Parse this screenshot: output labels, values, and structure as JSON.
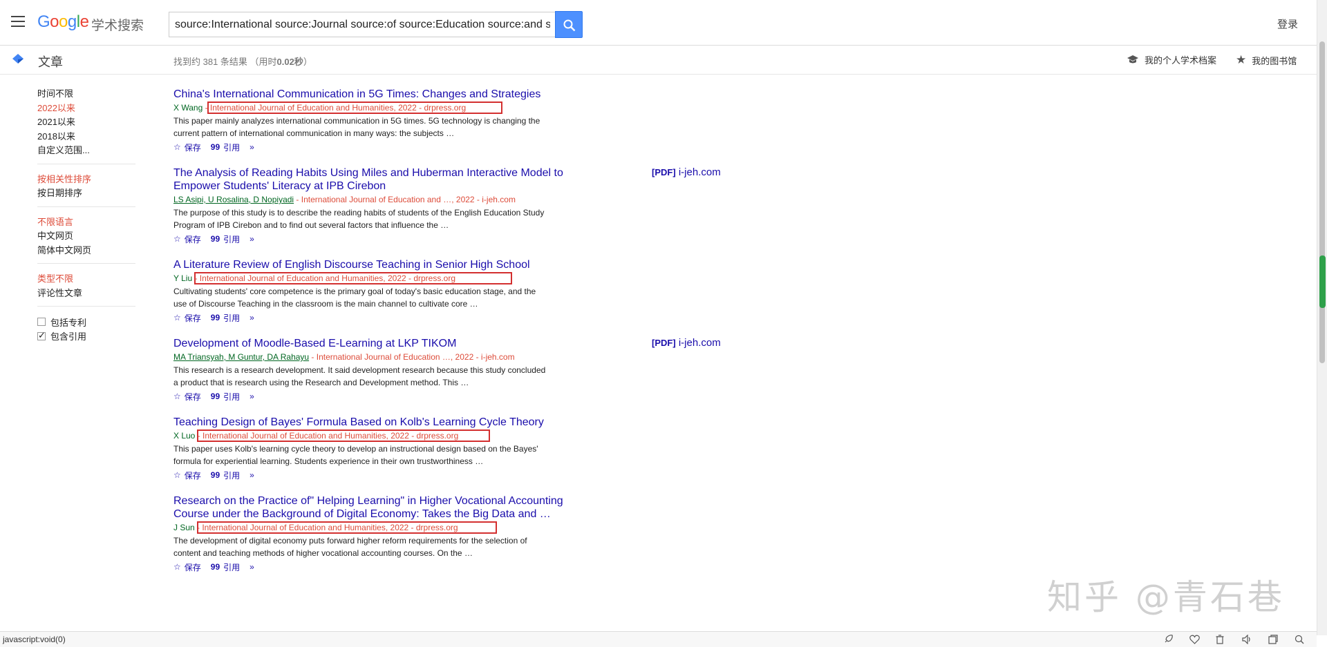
{
  "header": {
    "logo_cn": "学术搜索",
    "search_value": "source:International source:Journal source:of source:Education source:and s",
    "login_label": "登录"
  },
  "subheader": {
    "section_label": "文章",
    "stats_prefix": "找到约 381 条结果 （用时",
    "stats_time": "0.02秒",
    "stats_suffix": "）",
    "profile_label": "我的个人学术档案",
    "library_label": "我的图书馆"
  },
  "sidebar": {
    "time_items": [
      "时间不限",
      "2022以来",
      "2021以来",
      "2018以来",
      "自定义范围..."
    ],
    "sort_items": [
      "按相关性排序",
      "按日期排序"
    ],
    "lang_items": [
      "不限语言",
      "中文网页",
      "简体中文网页"
    ],
    "type_items": [
      "类型不限",
      "评论性文章"
    ],
    "include_patents": "包括专利",
    "include_citations": "包含引用"
  },
  "results": [
    {
      "title": "China's International Communication in 5G Times: Changes and Strategies",
      "authors": "X Wang",
      "venue": " - International Journal of Education and Humanities, 2022 - drpress.org",
      "snippet": "This paper mainly analyzes international communication in 5G times. 5G technology is changing the current pattern of international communication in many ways: the subjects …",
      "pdf": ""
    },
    {
      "title": "The Analysis of Reading Habits Using Miles and Huberman Interactive Model to Empower Students' Literacy at IPB Cirebon",
      "authors": "LS Asipi, U Rosalina, D Nopiyadi",
      "venue": " - International Journal of Education and …, 2022 - i-jeh.com",
      "snippet": "The purpose of this study is to describe the reading habits of students of the English Education Study Program of IPB Cirebon and to find out several factors that influence the …",
      "pdf_tag": "[PDF]",
      "pdf_host": "i-jeh.com"
    },
    {
      "title": "A Literature Review of English Discourse Teaching in Senior High School",
      "authors": "Y Liu",
      "venue": " - International Journal of Education and Humanities, 2022 - drpress.org",
      "snippet": "Cultivating students' core competence is the primary goal of today's basic education stage, and the use of Discourse Teaching in the classroom is the main channel to cultivate core …"
    },
    {
      "title": "Development of Moodle-Based E-Learning at LKP TIKOM",
      "authors": "MA Triansyah, M Guntur, DA Rahayu",
      "venue": " - International Journal of Education …, 2022 - i-jeh.com",
      "snippet": "This research is a research development. It said development research because this study concluded a product that is research using the Research and Development method. This …",
      "pdf_tag": "[PDF]",
      "pdf_host": "i-jeh.com"
    },
    {
      "title": "Teaching Design of Bayes' Formula Based on Kolb's Learning Cycle Theory",
      "authors": "X Luo",
      "venue": " - International Journal of Education and Humanities, 2022 - drpress.org",
      "snippet": "This paper uses Kolb's learning cycle theory to develop an instructional design based on the Bayes' formula for experiential learning. Students experience in their own trustworthiness …"
    },
    {
      "title": "Research on the Practice of\" Helping Learning\" in Higher Vocational Accounting Course under the Background of Digital Economy: Takes the Big Data and …",
      "authors": "J Sun",
      "venue": " - International Journal of Education and Humanities, 2022 - drpress.org",
      "snippet": "The development of digital economy puts forward higher reform requirements for the selection of content and teaching methods of higher vocational accounting courses. On the …"
    }
  ],
  "actions": {
    "save": "保存",
    "cite": "引用"
  },
  "watermark": "知乎 @青石巷",
  "status_text": "javascript:void(0)"
}
